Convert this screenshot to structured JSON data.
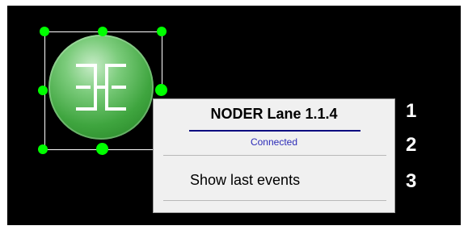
{
  "node": {
    "icon": "noder-logo-icon",
    "color": "#3fa53f"
  },
  "selection": {
    "handle_color": "#00ff00"
  },
  "context_menu": {
    "title": "NODER Lane 1.1.4",
    "status": "Connected",
    "items": [
      {
        "label": "Show last events"
      }
    ]
  },
  "callouts": [
    "1",
    "2",
    "3"
  ]
}
